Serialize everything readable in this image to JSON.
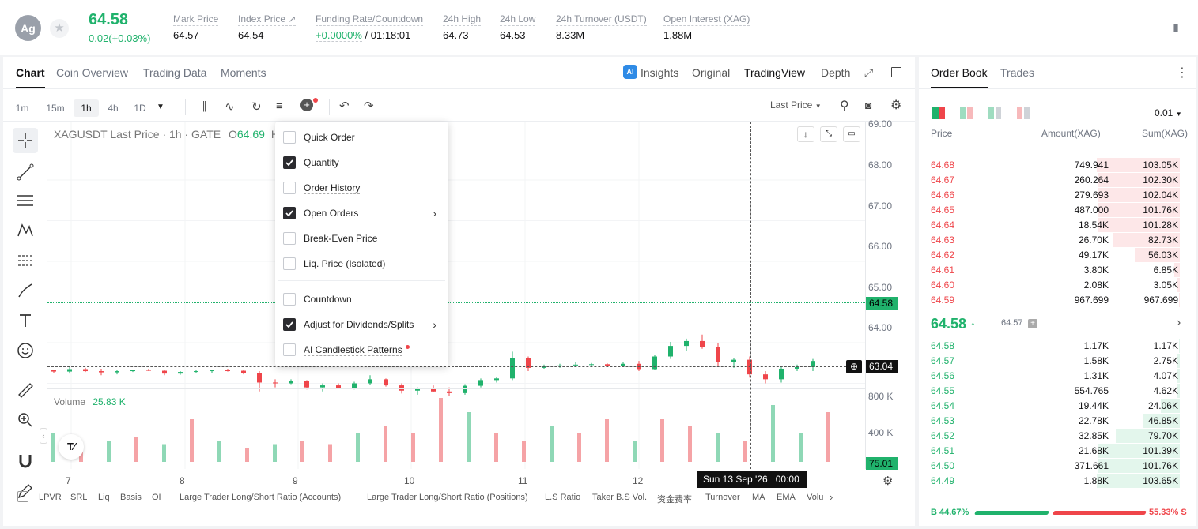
{
  "header": {
    "coin_icon": "Ag",
    "price": "64.58",
    "change": "0.02(+0.03%)",
    "stats": [
      {
        "label": "Mark Price",
        "value": "64.57"
      },
      {
        "label": "Index Price ↗",
        "value": "64.54"
      },
      {
        "label": "Funding Rate/Countdown",
        "value_green": "+0.0000%",
        "value": " / 01:18:01"
      },
      {
        "label": "24h High",
        "value": "64.73"
      },
      {
        "label": "24h Low",
        "value": "64.53"
      },
      {
        "label": "24h Turnover (USDT)",
        "value": "8.33M"
      },
      {
        "label": "Open Interest (XAG)",
        "value": "1.88M"
      }
    ]
  },
  "chart_tabs": [
    "Chart",
    "Coin Overview",
    "Trading Data",
    "Moments"
  ],
  "view_tabs": [
    "Insights",
    "Original",
    "TradingView",
    "Depth"
  ],
  "timeframes": [
    "1m",
    "15m",
    "1h",
    "4h",
    "1D"
  ],
  "last_price_dropdown": "Last Price",
  "legend": {
    "symbol": "XAGUSDT Last Price · 1h · GATE",
    "o_label": "O",
    "o_value": "64.69",
    "h_label": "H"
  },
  "volume": {
    "label": "Volume",
    "value": "25.83 K"
  },
  "price_axis": [
    "69.00",
    "68.00",
    "67.00",
    "66.00",
    "65.00",
    "64.00"
  ],
  "volume_axis": [
    "800 K",
    "400 K"
  ],
  "current_price_tag": "64.58",
  "crosshair_price_tag": "63.04",
  "volume_tag": "75.01",
  "date_axis": [
    "7",
    "8",
    "9",
    "10",
    "11",
    "12"
  ],
  "crosshair_date": "Sun 13 Sep '26",
  "crosshair_time": "00:00",
  "menu": {
    "items": [
      {
        "label": "Quick Order",
        "checked": false
      },
      {
        "label": "Quantity",
        "checked": true
      },
      {
        "label": "Order History",
        "checked": false
      },
      {
        "label": "Open Orders",
        "checked": true,
        "arrow": true
      },
      {
        "label": "Break-Even Price",
        "checked": false
      },
      {
        "label": "Liq. Price (Isolated)",
        "checked": false
      },
      {
        "label": "Countdown",
        "checked": false
      },
      {
        "label": "Adjust for Dividends/Splits",
        "checked": true,
        "arrow": true
      },
      {
        "label": "AI Candlestick Patterns",
        "checked": false
      }
    ]
  },
  "indicators": [
    "LPVR",
    "SRL",
    "Liq",
    "Basis",
    "OI",
    "Large Trader Long/Short Ratio (Accounts)",
    "Large Trader Long/Short Ratio (Positions)",
    "L.S Ratio",
    "Taker B.S Vol.",
    "资金费率",
    "Turnover",
    "MA",
    "EMA",
    "Volu"
  ],
  "orderbook": {
    "tabs": [
      "Order Book",
      "Trades"
    ],
    "precision": "0.01",
    "columns": [
      "Price",
      "Amount(XAG)",
      "Sum(XAG)"
    ],
    "asks": [
      {
        "price": "64.68",
        "amount": "749.941",
        "sum": "103.05K",
        "depth": 1.0
      },
      {
        "price": "64.67",
        "amount": "260.264",
        "sum": "102.30K",
        "depth": 0.99
      },
      {
        "price": "64.66",
        "amount": "279.693",
        "sum": "102.04K",
        "depth": 0.99
      },
      {
        "price": "64.65",
        "amount": "487.000",
        "sum": "101.76K",
        "depth": 0.99
      },
      {
        "price": "64.64",
        "amount": "18.54K",
        "sum": "101.28K",
        "depth": 0.98
      },
      {
        "price": "64.63",
        "amount": "26.70K",
        "sum": "82.73K",
        "depth": 0.8
      },
      {
        "price": "64.62",
        "amount": "49.17K",
        "sum": "56.03K",
        "depth": 0.54
      },
      {
        "price": "64.61",
        "amount": "3.80K",
        "sum": "6.85K",
        "depth": 0.07
      },
      {
        "price": "64.60",
        "amount": "2.08K",
        "sum": "3.05K",
        "depth": 0.03
      },
      {
        "price": "64.59",
        "amount": "967.699",
        "sum": "967.699",
        "depth": 0.01
      }
    ],
    "mid_price": "64.58",
    "mark_price": "64.57",
    "bids": [
      {
        "price": "64.58",
        "amount": "1.17K",
        "sum": "1.17K",
        "depth": 0.01
      },
      {
        "price": "64.57",
        "amount": "1.58K",
        "sum": "2.75K",
        "depth": 0.03
      },
      {
        "price": "64.56",
        "amount": "1.31K",
        "sum": "4.07K",
        "depth": 0.04
      },
      {
        "price": "64.55",
        "amount": "554.765",
        "sum": "4.62K",
        "depth": 0.04
      },
      {
        "price": "64.54",
        "amount": "19.44K",
        "sum": "24.06K",
        "depth": 0.23
      },
      {
        "price": "64.53",
        "amount": "22.78K",
        "sum": "46.85K",
        "depth": 0.45
      },
      {
        "price": "64.52",
        "amount": "32.85K",
        "sum": "79.70K",
        "depth": 0.77
      },
      {
        "price": "64.51",
        "amount": "21.68K",
        "sum": "101.39K",
        "depth": 0.98
      },
      {
        "price": "64.50",
        "amount": "371.661",
        "sum": "101.76K",
        "depth": 0.98
      },
      {
        "price": "64.49",
        "amount": "1.88K",
        "sum": "103.65K",
        "depth": 1.0
      }
    ],
    "buy_label": "B",
    "buy_pct": "44.67%",
    "sell_pct": "55.33%",
    "sell_label": "S",
    "buy_fraction": 0.4467
  },
  "colors": {
    "up": "#20b26c",
    "down": "#ef454a",
    "up_vol": "#8fd8b6",
    "down_vol": "#f5a3a6"
  },
  "candles": [
    [
      0,
      64.32,
      64.34,
      64.26,
      64.29
    ],
    [
      1,
      64.29,
      64.4,
      64.24,
      64.35
    ],
    [
      2,
      64.35,
      64.38,
      64.28,
      64.3
    ],
    [
      3,
      64.3,
      64.36,
      64.2,
      64.27
    ],
    [
      4,
      64.27,
      64.32,
      64.22,
      64.3
    ],
    [
      5,
      64.3,
      64.34,
      64.28,
      64.33
    ],
    [
      6,
      64.33,
      64.36,
      64.3,
      64.31
    ],
    [
      7,
      64.31,
      64.33,
      64.2,
      64.24
    ],
    [
      8,
      64.24,
      64.3,
      64.21,
      64.28
    ],
    [
      9,
      64.28,
      64.32,
      64.25,
      64.3
    ],
    [
      10,
      64.3,
      64.34,
      64.26,
      64.32
    ],
    [
      11,
      64.32,
      64.36,
      64.29,
      64.31
    ],
    [
      12,
      64.31,
      64.34,
      64.22,
      64.25
    ],
    [
      13,
      64.25,
      64.3,
      63.8,
      64.02
    ],
    [
      14,
      64.02,
      64.1,
      63.9,
      64.0
    ],
    [
      15,
      64.0,
      64.1,
      63.98,
      64.06
    ],
    [
      16,
      64.06,
      64.08,
      63.85,
      63.9
    ],
    [
      17,
      63.9,
      64.0,
      63.8,
      63.95
    ],
    [
      18,
      63.95,
      64.0,
      63.86,
      63.88
    ],
    [
      19,
      63.88,
      64.04,
      63.85,
      64.0
    ],
    [
      20,
      64.0,
      64.2,
      63.96,
      64.1
    ],
    [
      21,
      64.1,
      64.12,
      63.92,
      63.95
    ],
    [
      22,
      63.95,
      64.0,
      63.75,
      63.82
    ],
    [
      23,
      63.82,
      63.9,
      63.72,
      63.86
    ],
    [
      24,
      63.86,
      63.95,
      63.78,
      63.8
    ],
    [
      25,
      63.8,
      63.9,
      63.7,
      63.76
    ],
    [
      26,
      63.76,
      63.98,
      63.72,
      63.94
    ],
    [
      27,
      63.94,
      64.12,
      63.9,
      64.08
    ],
    [
      28,
      64.08,
      64.16,
      64.02,
      64.12
    ],
    [
      29,
      64.12,
      64.78,
      64.08,
      64.62
    ],
    [
      30,
      64.62,
      64.66,
      64.3,
      64.38
    ],
    [
      31,
      64.38,
      64.46,
      64.36,
      64.42
    ],
    [
      32,
      64.42,
      64.48,
      64.38,
      64.44
    ],
    [
      33,
      64.44,
      64.52,
      64.4,
      64.46
    ],
    [
      34,
      64.46,
      64.5,
      64.43,
      64.47
    ],
    [
      35,
      64.47,
      64.49,
      64.4,
      64.43
    ],
    [
      36,
      64.43,
      64.52,
      64.4,
      64.48
    ],
    [
      37,
      64.48,
      64.55,
      64.3,
      64.35
    ],
    [
      38,
      64.35,
      64.7,
      64.32,
      64.66
    ],
    [
      39,
      64.66,
      65.02,
      64.6,
      64.92
    ],
    [
      40,
      64.92,
      65.1,
      64.8,
      65.04
    ],
    [
      41,
      65.04,
      65.2,
      64.85,
      64.9
    ],
    [
      42,
      64.9,
      64.98,
      64.4,
      64.52
    ],
    [
      43,
      64.52,
      64.62,
      64.38,
      64.58
    ],
    [
      44,
      64.58,
      64.66,
      64.14,
      64.22
    ],
    [
      45,
      64.22,
      64.3,
      64.0,
      64.1
    ],
    [
      46,
      64.1,
      64.4,
      64.02,
      64.36
    ],
    [
      47,
      64.36,
      64.46,
      64.3,
      64.4
    ],
    [
      48,
      64.4,
      64.6,
      64.3,
      64.55
    ]
  ],
  "volumes": [
    [
      0,
      40,
      1
    ],
    [
      1,
      20,
      0
    ],
    [
      2,
      30,
      1
    ],
    [
      3,
      35,
      0
    ],
    [
      4,
      25,
      1
    ],
    [
      5,
      60,
      0
    ],
    [
      6,
      30,
      1
    ],
    [
      7,
      20,
      0
    ],
    [
      8,
      25,
      1
    ],
    [
      9,
      30,
      0
    ],
    [
      10,
      25,
      0
    ],
    [
      11,
      40,
      1
    ],
    [
      12,
      50,
      0
    ],
    [
      13,
      40,
      0
    ],
    [
      14,
      90,
      0
    ],
    [
      15,
      70,
      1
    ],
    [
      16,
      40,
      0
    ],
    [
      17,
      30,
      0
    ],
    [
      18,
      50,
      1
    ],
    [
      19,
      40,
      0
    ],
    [
      20,
      60,
      0
    ],
    [
      21,
      30,
      1
    ],
    [
      22,
      60,
      0
    ],
    [
      23,
      50,
      0
    ],
    [
      24,
      40,
      1
    ],
    [
      25,
      30,
      0
    ],
    [
      26,
      80,
      1
    ],
    [
      27,
      40,
      1
    ],
    [
      28,
      70,
      0
    ]
  ]
}
